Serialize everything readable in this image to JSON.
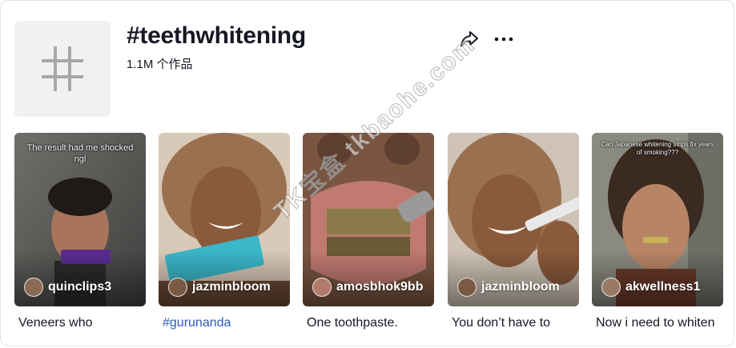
{
  "colors": {
    "text": "#161823",
    "link": "#2b5db9",
    "avatar_bg": "#f1f1f2",
    "hash_icon": "#a8a8ab"
  },
  "header": {
    "title": "#teethwhitening",
    "post_count": "1.1M",
    "post_count_suffix": "个作品",
    "icons": [
      "hashtag-icon",
      "share-icon",
      "more-icon"
    ]
  },
  "videos": [
    {
      "author": "quinclips3",
      "caption": "Veneers who",
      "caption_is_tag": false,
      "overlay": "The result had me shocked ngl"
    },
    {
      "author": "jazminbloom",
      "caption": "#gurunanda",
      "caption_is_tag": true,
      "overlay": ""
    },
    {
      "author": "amosbhok9bb",
      "caption": "One toothpaste.",
      "caption_is_tag": false,
      "overlay": ""
    },
    {
      "author": "jazminbloom",
      "caption": "You don’t have to",
      "caption_is_tag": false,
      "overlay": ""
    },
    {
      "author": "akwellness1",
      "caption": "Now i need to whiten",
      "caption_is_tag": false,
      "overlay": "Can Japanese whitening strips fix years of smoking???"
    }
  ],
  "watermark": "TK宝盒 tkbaohe.com"
}
